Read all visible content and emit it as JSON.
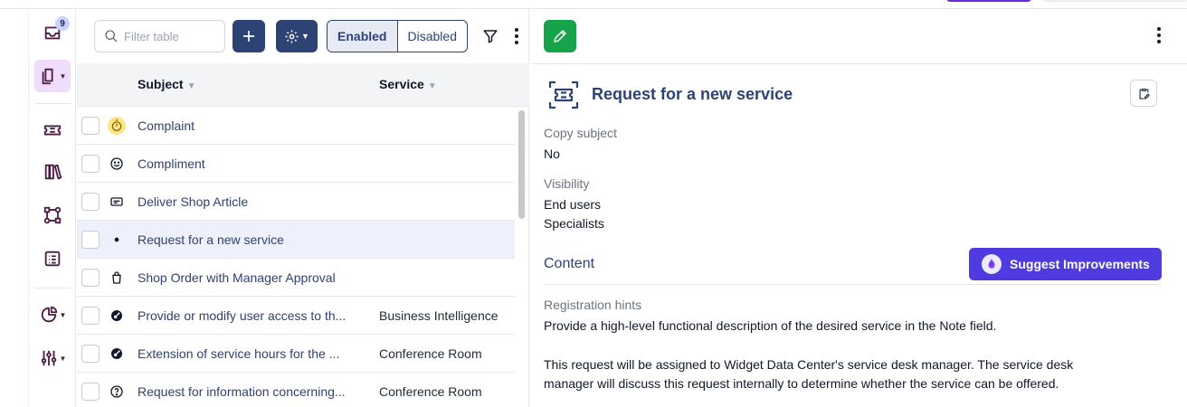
{
  "rail": {
    "inbox_badge": "9"
  },
  "toolbar": {
    "search_placeholder": "Filter table",
    "enabled_label": "Enabled",
    "disabled_label": "Disabled"
  },
  "table": {
    "columns": [
      "Subject",
      "Service"
    ],
    "rows": [
      {
        "subject": "Complaint",
        "service": "",
        "icon": "stopwatch-icon"
      },
      {
        "subject": "Compliment",
        "service": "",
        "icon": "smiley-icon"
      },
      {
        "subject": "Deliver Shop Article",
        "service": "",
        "icon": "card-icon"
      },
      {
        "subject": "Request for a new service",
        "service": "",
        "icon": "dot-icon"
      },
      {
        "subject": "Shop Order with Manager Approval",
        "service": "",
        "icon": "shopping-bag-icon"
      },
      {
        "subject": "Provide or modify user access to th...",
        "service": "Business Intelligence",
        "icon": "key-icon"
      },
      {
        "subject": "Extension of service hours for the ...",
        "service": "Conference Room",
        "icon": "key-icon"
      },
      {
        "subject": "Request for information concerning...",
        "service": "Conference Room",
        "icon": "question-icon"
      }
    ]
  },
  "detail": {
    "title": "Request for a new service",
    "copy_subject_label": "Copy subject",
    "copy_subject_value": "No",
    "visibility_label": "Visibility",
    "visibility_values": [
      "End users",
      "Specialists"
    ],
    "content_heading": "Content",
    "suggest_label": "Suggest Improvements",
    "registration_hints_label": "Registration hints",
    "hint_line1": "Provide a high-level functional description of the desired service in the Note field.",
    "hint_line2": "This request will be assigned to Widget Data Center's service desk manager. The service desk",
    "hint_line3": "manager will discuss this request internally to determine whether the service can be offered."
  },
  "colors": {
    "primary": "#2d4373",
    "edit_green": "#16a34a",
    "suggest_purple": "#4f3be0",
    "rail_active": "#f0dcfb",
    "selected_row": "#eef0fb"
  }
}
